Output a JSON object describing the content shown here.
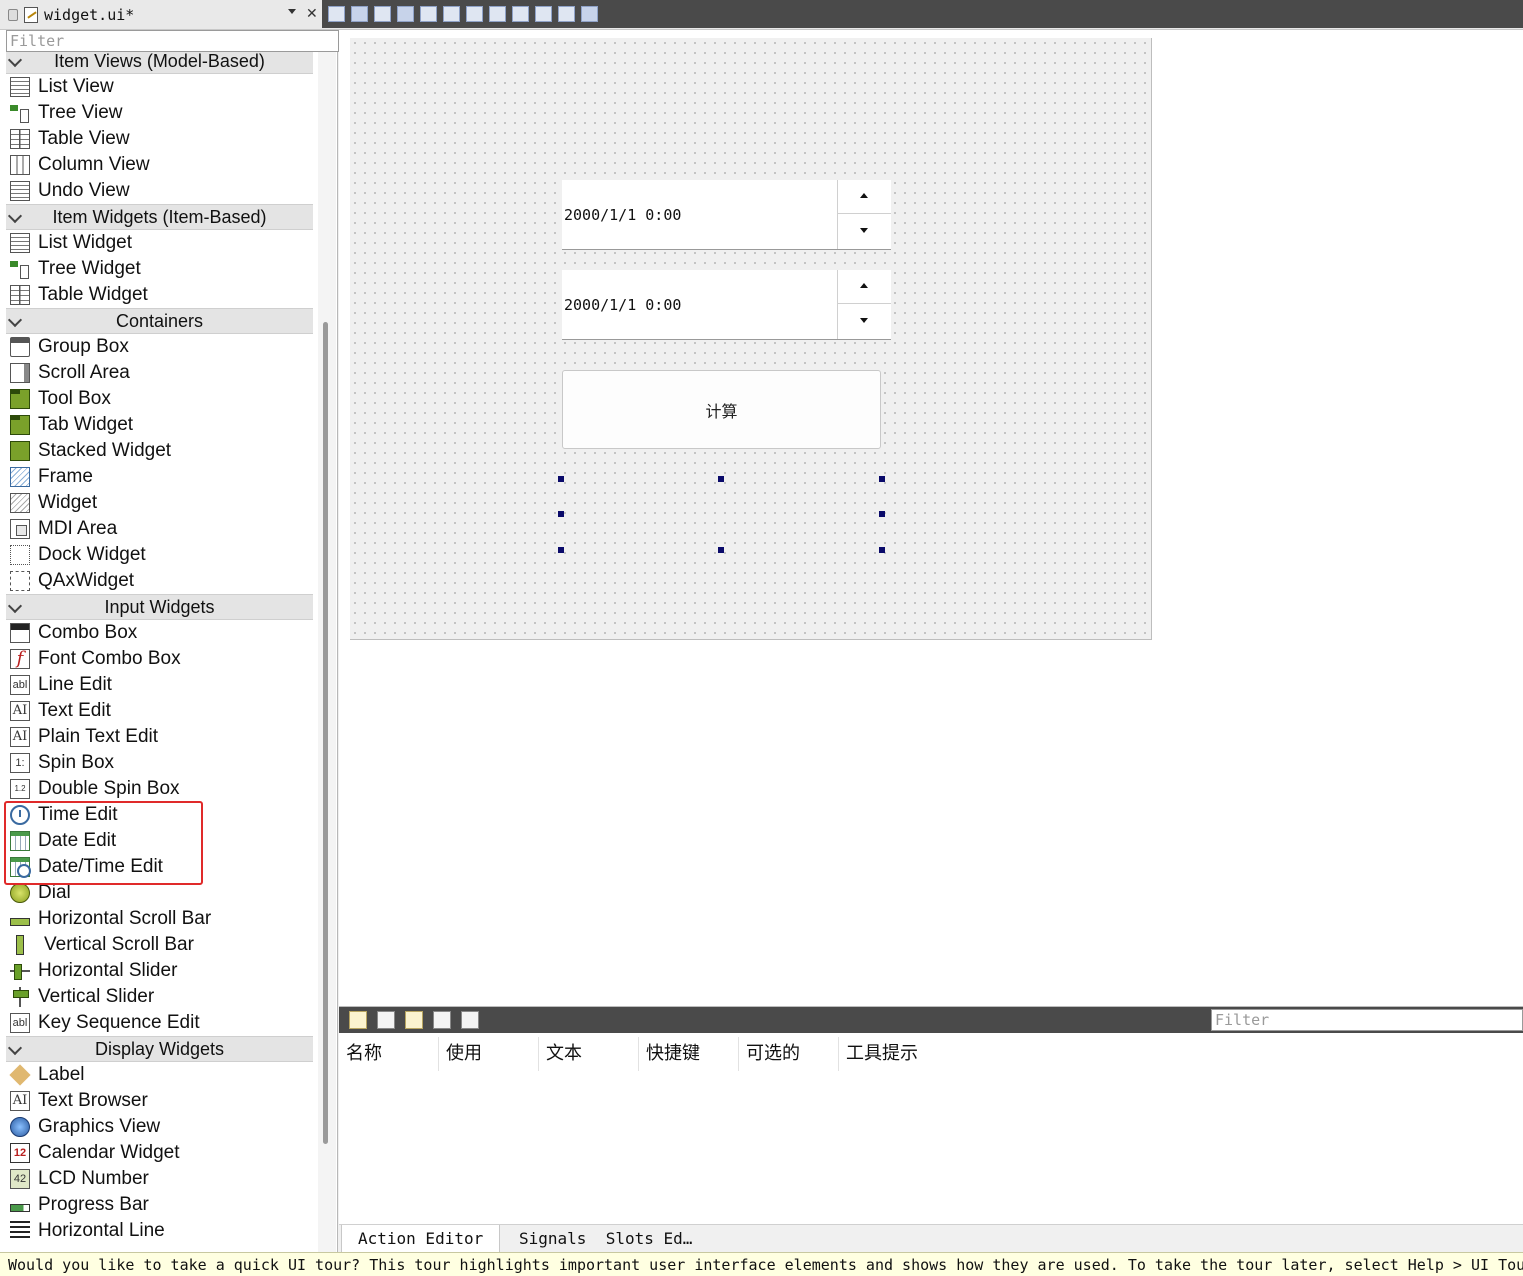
{
  "title_bar": {
    "file_name": "widget.ui*",
    "close_label": "✕"
  },
  "widget_box": {
    "filter_placeholder": "Filter",
    "categories": [
      {
        "name": "Item Views (Model-Based)",
        "items": [
          "List View",
          "Tree View",
          "Table View",
          "Column View",
          "Undo View"
        ]
      },
      {
        "name": "Item Widgets (Item-Based)",
        "items": [
          "List Widget",
          "Tree Widget",
          "Table Widget"
        ]
      },
      {
        "name": "Containers",
        "items": [
          "Group Box",
          "Scroll Area",
          "Tool Box",
          "Tab Widget",
          "Stacked Widget",
          "Frame",
          "Widget",
          "MDI Area",
          "Dock Widget",
          "QAxWidget"
        ]
      },
      {
        "name": "Input Widgets",
        "items": [
          "Combo Box",
          "Font Combo Box",
          "Line Edit",
          "Text Edit",
          "Plain Text Edit",
          "Spin Box",
          "Double Spin Box",
          "Time Edit",
          "Date Edit",
          "Date/Time Edit",
          "Dial",
          "Horizontal Scroll Bar",
          "Vertical Scroll Bar",
          "Horizontal Slider",
          "Vertical Slider",
          "Key Sequence Edit"
        ]
      },
      {
        "name": "Display Widgets",
        "items": [
          "Label",
          "Text Browser",
          "Graphics View",
          "Calendar Widget",
          "LCD Number",
          "Progress Bar",
          "Horizontal Line"
        ]
      }
    ],
    "highlight_color": "#e02a2a"
  },
  "form": {
    "datetime_edit_1": {
      "value": "2000/1/1 0:00"
    },
    "datetime_edit_2": {
      "value": "2000/1/1 0:00"
    },
    "calc_button": {
      "label": "计算"
    }
  },
  "action_editor": {
    "filter_placeholder": "Filter",
    "columns": [
      "名称",
      "使用",
      "文本",
      "快捷键",
      "可选的",
      "工具提示"
    ]
  },
  "bottom_tabs": {
    "action_editor": "Action Editor",
    "signals_slots": "Signals  Slots Ed…"
  },
  "status_bar": {
    "message": "Would you like to take a quick UI tour? This tour highlights important user interface elements and shows how they are used. To take the tour later, select Help > UI Tour"
  }
}
